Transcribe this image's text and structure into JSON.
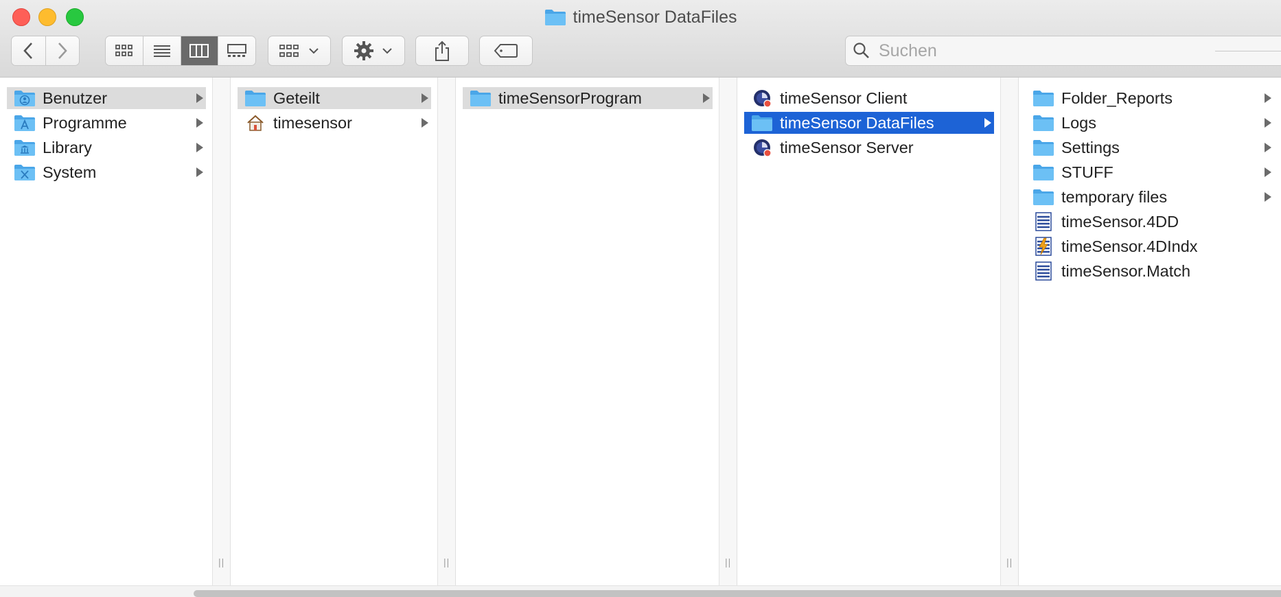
{
  "window": {
    "title": "timeSensor DataFiles"
  },
  "toolbar": {
    "search_placeholder": "Suchen",
    "view_mode": "columns"
  },
  "columns": [
    {
      "items": [
        {
          "label": "Benutzer",
          "icon": "user-folder-icon",
          "state": "path",
          "arrow": true
        },
        {
          "label": "Programme",
          "icon": "applications-folder-icon",
          "state": "",
          "arrow": true
        },
        {
          "label": "Library",
          "icon": "library-folder-icon",
          "state": "",
          "arrow": true
        },
        {
          "label": "System",
          "icon": "system-folder-icon",
          "state": "",
          "arrow": true
        }
      ]
    },
    {
      "items": [
        {
          "label": "Geteilt",
          "icon": "folder-icon",
          "state": "path",
          "arrow": true
        },
        {
          "label": "timesensor",
          "icon": "home-icon",
          "state": "",
          "arrow": true
        }
      ]
    },
    {
      "items": [
        {
          "label": "timeSensorProgram",
          "icon": "folder-icon",
          "state": "path",
          "arrow": true
        }
      ]
    },
    {
      "items": [
        {
          "label": "timeSensor Client",
          "icon": "app-icon",
          "state": "",
          "arrow": false
        },
        {
          "label": "timeSensor DataFiles",
          "icon": "folder-icon",
          "state": "selected",
          "arrow": true
        },
        {
          "label": "timeSensor Server",
          "icon": "app-icon",
          "state": "",
          "arrow": false
        }
      ]
    },
    {
      "items": [
        {
          "label": "Folder_Reports",
          "icon": "folder-icon",
          "state": "",
          "arrow": true
        },
        {
          "label": "Logs",
          "icon": "folder-icon",
          "state": "",
          "arrow": true
        },
        {
          "label": "Settings",
          "icon": "folder-icon",
          "state": "",
          "arrow": true
        },
        {
          "label": "STUFF",
          "icon": "folder-icon",
          "state": "",
          "arrow": true
        },
        {
          "label": "temporary files",
          "icon": "folder-icon",
          "state": "",
          "arrow": true
        },
        {
          "label": "timeSensor.4DD",
          "icon": "data-file-icon",
          "state": "",
          "arrow": false
        },
        {
          "label": "timeSensor.4DIndx",
          "icon": "index-file-icon",
          "state": "",
          "arrow": false
        },
        {
          "label": "timeSensor.Match",
          "icon": "data-file-icon",
          "state": "",
          "arrow": false
        }
      ]
    }
  ]
}
